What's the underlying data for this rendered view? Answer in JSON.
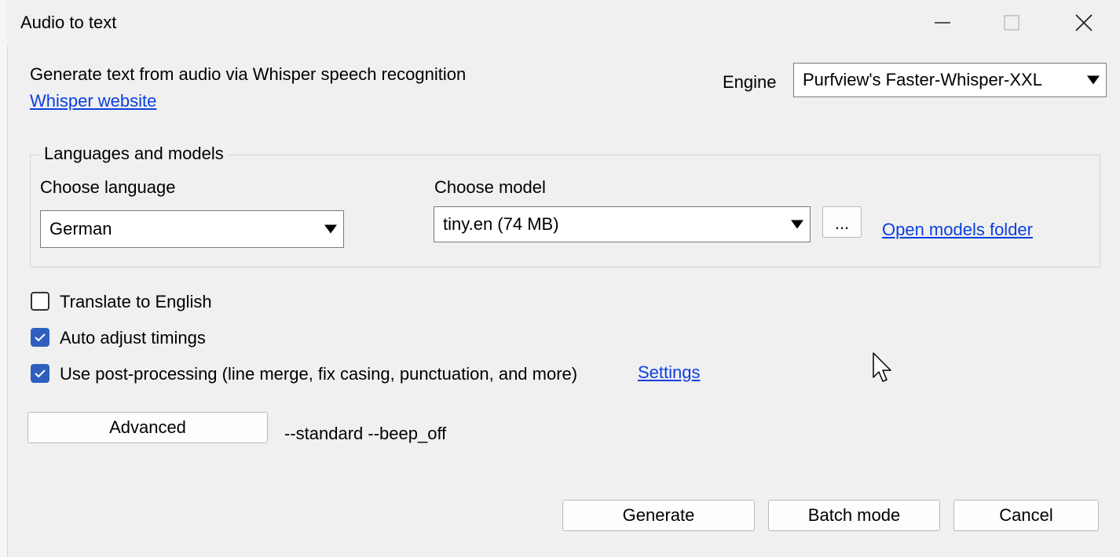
{
  "window": {
    "title": "Audio to text",
    "controls": [
      "minimize-icon",
      "maximize-icon",
      "close-icon"
    ]
  },
  "intro": {
    "description": "Generate text from audio via Whisper speech recognition",
    "website_link": "Whisper website"
  },
  "engine": {
    "label": "Engine",
    "selected": "Purfview's Faster-Whisper-XXL"
  },
  "languages_models": {
    "legend": "Languages and models",
    "language_label": "Choose language",
    "language_selected": "German",
    "model_label": "Choose model",
    "model_selected": "tiny.en (74 MB)",
    "browse_button": "...",
    "open_folder_link": "Open models folder"
  },
  "options": {
    "translate": {
      "label": "Translate to English",
      "checked": false
    },
    "auto_adjust": {
      "label": "Auto adjust timings",
      "checked": true
    },
    "post_processing": {
      "label": "Use post-processing (line merge, fix casing, punctuation, and more)",
      "checked": true,
      "settings_link": "Settings"
    }
  },
  "advanced": {
    "button": "Advanced",
    "params": "--standard --beep_off"
  },
  "footer": {
    "generate": "Generate",
    "batch_mode": "Batch mode",
    "cancel": "Cancel"
  },
  "colors": {
    "background": "#f0f0f0",
    "link": "#0b3fe0",
    "checkbox_checked": "#2f5fbe"
  }
}
